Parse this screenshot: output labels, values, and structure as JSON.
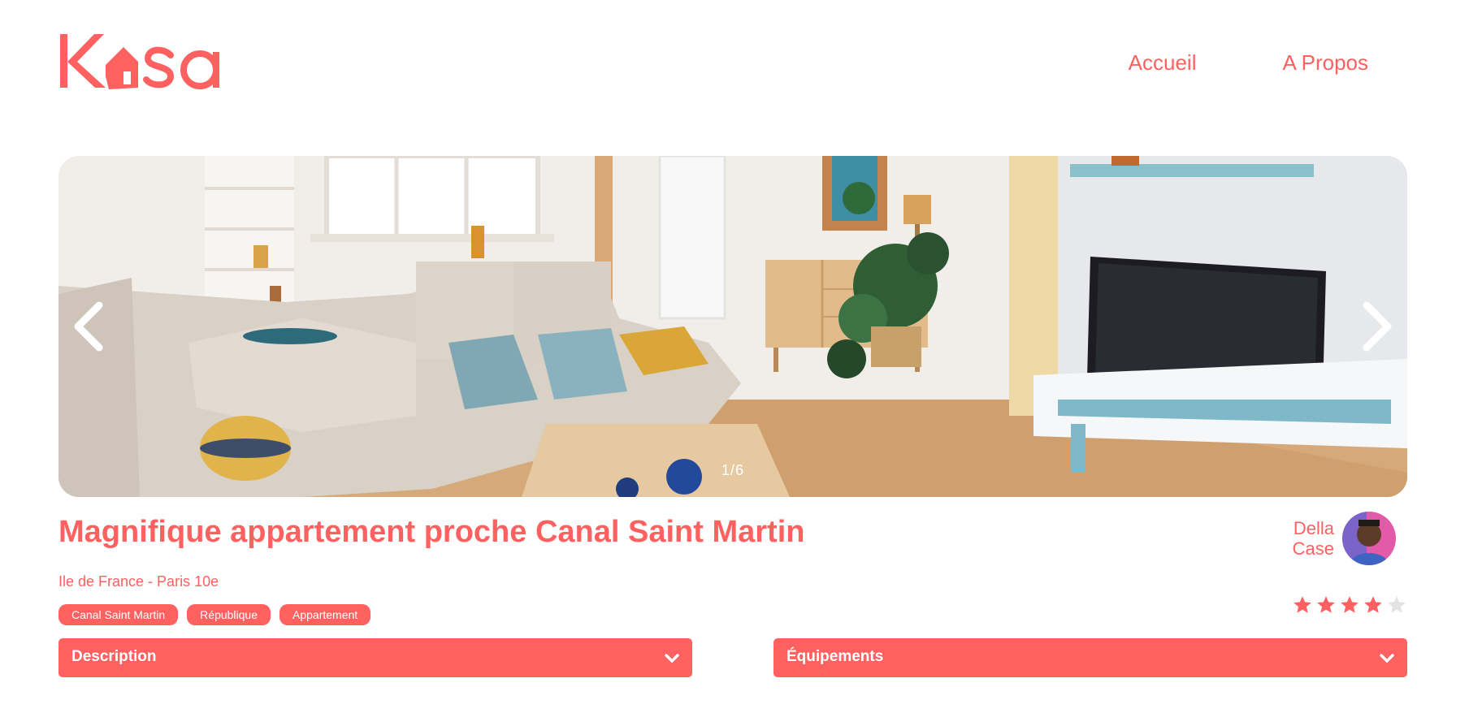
{
  "header": {
    "logo_text": "Kasa",
    "nav": [
      {
        "label": "Accueil"
      },
      {
        "label": "A Propos"
      }
    ]
  },
  "carousel": {
    "counter": "1/6",
    "current": 1,
    "total": 6
  },
  "listing": {
    "title": "Magnifique appartement proche Canal Saint Martin",
    "location": "Ile de France - Paris 10e",
    "tags": [
      "Canal Saint Martin",
      "République",
      "Appartement"
    ],
    "rating": 4,
    "rating_max": 5
  },
  "host": {
    "first_name": "Della",
    "last_name": "Case"
  },
  "collapses": {
    "description": "Description",
    "equipements": "Équipements"
  },
  "colors": {
    "brand": "#FF6060",
    "star_empty": "#E3E3E3"
  }
}
